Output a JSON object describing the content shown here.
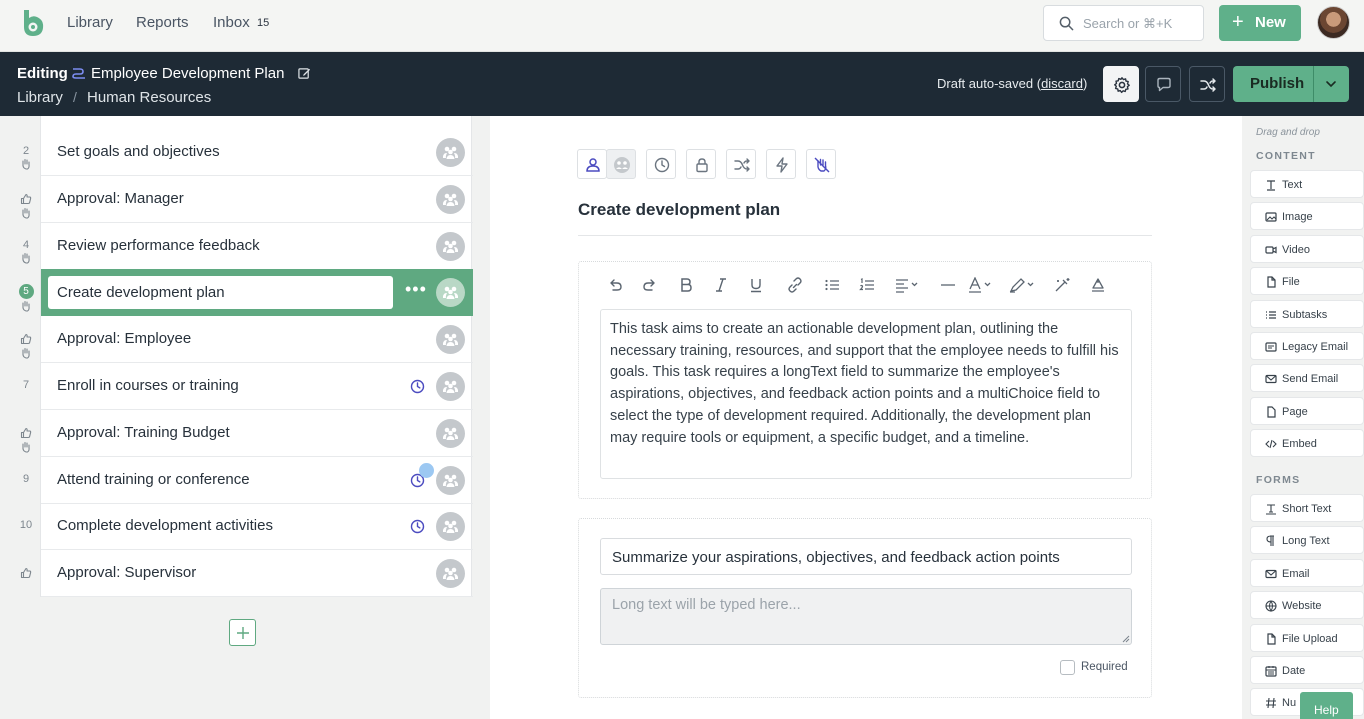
{
  "nav": {
    "library": "Library",
    "reports": "Reports",
    "inbox": "Inbox",
    "inbox_count": "15",
    "search_placeholder": "Search or ⌘+K",
    "new_label": "New"
  },
  "header": {
    "mode": "Editing",
    "title": "Employee Development Plan",
    "breadcrumb": [
      "Library",
      "Human Resources"
    ],
    "draft_status": "Draft auto-saved",
    "discard": "discard",
    "publish": "Publish"
  },
  "tasks": [
    {
      "num": "2",
      "label": "Set goals and objectives",
      "icon": "hand-icon",
      "clock": false
    },
    {
      "num": "",
      "label": "Approval: Manager",
      "icon": "thumbs-up-icon",
      "clock": false
    },
    {
      "num": "4",
      "label": "Review performance feedback",
      "icon": "hand-icon",
      "clock": false
    },
    {
      "num": "5",
      "label": "Create development plan",
      "icon": "hand-icon",
      "clock": false,
      "active": true
    },
    {
      "num": "",
      "label": "Approval: Employee",
      "icon": "thumbs-up-icon",
      "clock": false
    },
    {
      "num": "7",
      "label": "Enroll in courses or training",
      "icon": "",
      "clock": true
    },
    {
      "num": "",
      "label": "Approval: Training Budget",
      "icon": "thumbs-up-icon",
      "clock": false
    },
    {
      "num": "9",
      "label": "Attend training or conference",
      "icon": "",
      "clock": true
    },
    {
      "num": "10",
      "label": "Complete development activities",
      "icon": "",
      "clock": true
    },
    {
      "num": "",
      "label": "Approval: Supervisor",
      "icon": "thumbs-up-icon",
      "clock": false
    }
  ],
  "editor": {
    "task_title": "Create development plan",
    "description": "This task aims to create an actionable development plan, outlining the necessary training, resources, and support that the employee needs to fulfill his goals. This task requires a longText field to summarize the employee's aspirations, objectives, and feedback action points and a multiChoice field to select the type of development required. Additionally, the development plan may require tools or equipment, a specific budget, and a timeline.",
    "question": "Summarize your aspirations, objectives, and feedback action points",
    "long_text_placeholder": "Long text will be typed here...",
    "required_label": "Required"
  },
  "palette": {
    "hint": "Drag and drop",
    "content_heading": "CONTENT",
    "content_items": [
      "Text",
      "Image",
      "Video",
      "File",
      "Subtasks",
      "Legacy Email",
      "Send Email",
      "Page",
      "Embed"
    ],
    "forms_heading": "FORMS",
    "form_items": [
      "Short Text",
      "Long Text",
      "Email",
      "Website",
      "File Upload",
      "Date",
      "Nu"
    ]
  },
  "help": "Help",
  "colors": {
    "brand_green": "#5fb08a",
    "header_dark": "#1e2a35",
    "active_row": "#5fa981",
    "accent_purple": "#4b4bc0"
  }
}
